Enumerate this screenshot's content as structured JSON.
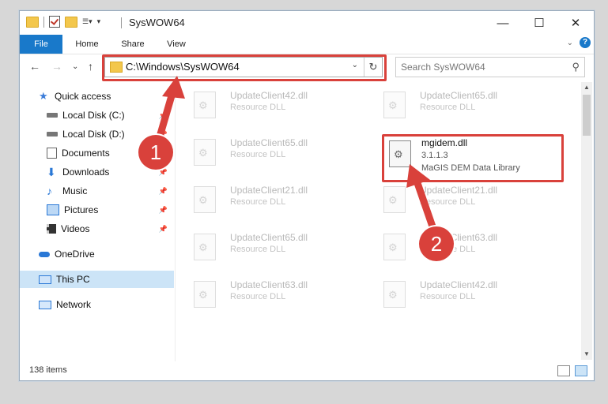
{
  "window": {
    "title": "SysWOW64",
    "controls": {
      "minimize": "—",
      "maximize": "☐",
      "close": "✕"
    }
  },
  "ribbon": {
    "tabs": [
      "File",
      "Home",
      "Share",
      "View"
    ],
    "help": "?",
    "collapse": "⌄"
  },
  "nav": {
    "back": "←",
    "forward": "→",
    "recent": "⌄",
    "up": "↑",
    "address": "C:\\Windows\\SysWOW64",
    "refresh": "↻",
    "search_placeholder": "Search SysWOW64"
  },
  "sidebar": {
    "items": [
      {
        "label": "Quick access",
        "icon": "star-icon",
        "pinned": false
      },
      {
        "label": "Local Disk (C:)",
        "icon": "drive-icon",
        "pinned": true
      },
      {
        "label": "Local Disk (D:)",
        "icon": "drive-icon",
        "pinned": true
      },
      {
        "label": "Documents",
        "icon": "documents-icon",
        "pinned": true
      },
      {
        "label": "Downloads",
        "icon": "downloads-icon",
        "pinned": true
      },
      {
        "label": "Music",
        "icon": "music-icon",
        "pinned": true
      },
      {
        "label": "Pictures",
        "icon": "pictures-icon",
        "pinned": true
      },
      {
        "label": "Videos",
        "icon": "videos-icon",
        "pinned": true
      },
      {
        "label": "OneDrive",
        "icon": "cloud-icon",
        "pinned": false
      },
      {
        "label": "This PC",
        "icon": "computer-icon",
        "pinned": false
      },
      {
        "label": "Network",
        "icon": "network-icon",
        "pinned": false
      }
    ]
  },
  "files": {
    "faded": [
      {
        "name": "UpdateClient42.dll",
        "type": "Resource DLL"
      },
      {
        "name": "UpdateClient65.dll",
        "type": "Resource DLL"
      },
      {
        "name": "UpdateClient65.dll",
        "type": "Resource DLL"
      },
      {
        "name": "UpdateClient21.dll",
        "type": "Resource DLL"
      },
      {
        "name": "UpdateClient21.dll",
        "type": "Resource DLL"
      },
      {
        "name": "UpdateClient65.dll",
        "type": "Resource DLL"
      },
      {
        "name": "UpdateClient63.dll",
        "type": "Resource DLL"
      },
      {
        "name": "UpdateClient63.dll",
        "type": "Resource DLL"
      },
      {
        "name": "UpdateClient42.dll",
        "type": "Resource DLL"
      }
    ],
    "highlighted": {
      "name": "mgidem.dll",
      "version": "3.1.1.3",
      "description": "MaGIS DEM Data Library"
    }
  },
  "status": {
    "item_count": "138 items"
  },
  "annotations": {
    "step1": "1",
    "step2": "2",
    "color": "#d9413b"
  }
}
